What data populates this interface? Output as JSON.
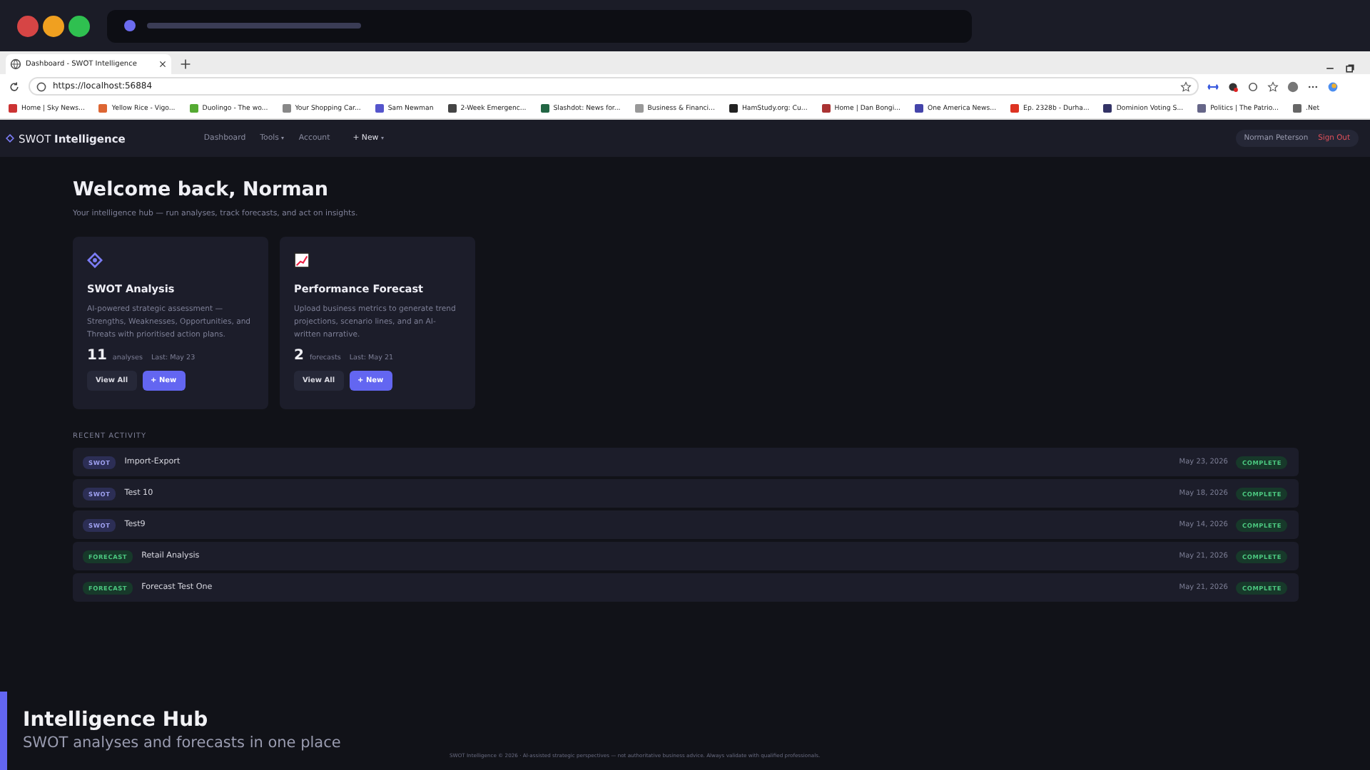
{
  "browser": {
    "tab_title": "Dashboard - SWOT Intelligence",
    "url": "https://localhost:56884",
    "bookmarks": [
      "Home | Sky News...",
      "Yellow Rice - Vigo...",
      "Duolingo - The wo...",
      "Your Shopping Car...",
      "Sam Newman",
      "2-Week Emergenc...",
      "Slashdot: News for...",
      "Business & Financi...",
      "HamStudy.org: Cu...",
      "Home | Dan Bongi...",
      "One America News...",
      "Ep. 2328b - Durha...",
      "Dominion Voting S...",
      "Politics | The Patrio...",
      ".Net"
    ]
  },
  "app": {
    "brand": "SWOT **Intelligence**",
    "nav": [
      {
        "label": "Dashboard",
        "dropdown": false
      },
      {
        "label": "Tools",
        "dropdown": true
      },
      {
        "label": "Account",
        "dropdown": false
      },
      {
        "label": "+ New",
        "dropdown": true
      }
    ],
    "user": "Norman Peterson",
    "sign_out": "Sign Out"
  },
  "heading": "Welcome back, Norman",
  "subtitle": "Your intelligence hub — run analyses, track forecasts, and act on insights.",
  "cards": [
    {
      "kind": "swot",
      "title": "SWOT Analysis",
      "description": "AI-powered strategic assessment — Strengths, Weaknesses, Opportunities, and Threats with prioritised action plans.",
      "count": "11",
      "count_label": "analyses",
      "last": "Last: May 23",
      "buttons": [
        "View All",
        "+ New"
      ]
    },
    {
      "kind": "forecast",
      "title": "Performance Forecast",
      "description": "Upload business metrics to generate trend projections, scenario lines, and an AI-written narrative.",
      "count": "2",
      "count_label": "forecasts",
      "last": "Last: May 21",
      "buttons": [
        "View All",
        "+ New"
      ]
    }
  ],
  "recent_activity": {
    "label": "RECENT ACTIVITY",
    "rows": [
      {
        "kind": "swot",
        "tag": "SWOT",
        "name": "Import-Export",
        "date": "May 23, 2026",
        "status": "COMPLETE"
      },
      {
        "kind": "swot",
        "tag": "SWOT",
        "name": "Test 10",
        "date": "May 18, 2026",
        "status": "COMPLETE"
      },
      {
        "kind": "swot",
        "tag": "SWOT",
        "name": "Test9",
        "date": "May 14, 2026",
        "status": "COMPLETE"
      },
      {
        "kind": "forecast",
        "tag": "FORECAST",
        "name": "Retail Analysis",
        "date": "May 21, 2026",
        "status": "COMPLETE"
      },
      {
        "kind": "forecast",
        "tag": "FORECAST",
        "name": "Forecast Test One",
        "date": "May 21, 2026",
        "status": "COMPLETE"
      }
    ]
  },
  "footer": "SWOT Intelligence © 2026 · AI-assisted strategic perspectives — not authoritative business advice. Always validate with qualified professionals.",
  "caption": {
    "title": "Intelligence Hub",
    "subtitle": "SWOT analyses and forecasts in one place"
  }
}
